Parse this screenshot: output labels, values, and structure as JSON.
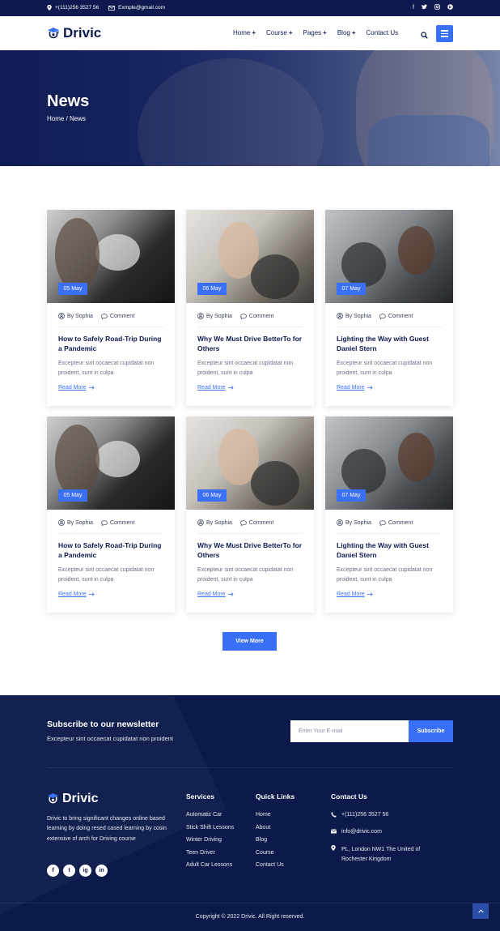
{
  "topbar": {
    "phone": "+(111)256 3527 56",
    "email": "Exmple@gmail.com",
    "social": [
      "facebook-icon",
      "twitter-icon",
      "instagram-icon",
      "pinterest-icon"
    ]
  },
  "header": {
    "brand": "Drivic",
    "nav": [
      {
        "label": "Home",
        "plus": "+"
      },
      {
        "label": "Course",
        "plus": "+"
      },
      {
        "label": "Pages",
        "plus": "+"
      },
      {
        "label": "Blog",
        "plus": "+"
      },
      {
        "label": "Contact Us",
        "plus": ""
      }
    ]
  },
  "hero": {
    "title": "News",
    "breadcrumb": "Home / News"
  },
  "posts": [
    {
      "date": "05 May",
      "author": "By Sophia",
      "comment": "Comment",
      "title": "How to Safely Road-Trip During a Pandemic",
      "desc": "Excepteur sint occaecat cupidatat non proident, sunt in culpa",
      "more": "Read More"
    },
    {
      "date": "06 May",
      "author": "By Sophia",
      "comment": "Comment",
      "title": "Why We Must Drive BetterTo for Others",
      "desc": "Excepteur sint occaecat cupidatat non proident, sunt in culpa",
      "more": "Read More"
    },
    {
      "date": "07 May",
      "author": "By Sophia",
      "comment": "Comment",
      "title": "Lighting the Way with Guest Daniel Stern",
      "desc": "Excepteur sint occaecat cupidatat non proident, sunt in culpa",
      "more": "Read More"
    },
    {
      "date": "05 May",
      "author": "By Sophia",
      "comment": "Comment",
      "title": "How to Safely Road-Trip During a Pandemic",
      "desc": "Excepteur sint occaecat cupidatat non proident, sunt in culpa",
      "more": "Read More"
    },
    {
      "date": "06 May",
      "author": "By Sophia",
      "comment": "Comment",
      "title": "Why We Must Drive BetterTo for Others",
      "desc": "Excepteur sint occaecat cupidatat non proident, sunt in culpa",
      "more": "Read More"
    },
    {
      "date": "07 May",
      "author": "By Sophia",
      "comment": "Comment",
      "title": "Lighting the Way with Guest Daniel Stern",
      "desc": "Excepteur sint occaecat cupidatat non proident, sunt in culpa",
      "more": "Read More"
    }
  ],
  "view_more": "View More",
  "newsletter": {
    "title": "Subscribe to our newsletter",
    "subtitle": "Excepteur sint occaecat cupidatat non proident",
    "placeholder": "Enter Your E-mail",
    "button": "Subscribe"
  },
  "footer": {
    "brand": "Drivic",
    "about": "Drivic to bring significant changes online based learning by doing resed cased learning by cosin extensive of arch for Driving course",
    "social": [
      "f",
      "t",
      "ig",
      "in"
    ],
    "services_title": "Services",
    "services": [
      "Automatic Car",
      "Stick Shift Lessons",
      "Winter Driving",
      "Teen Driver",
      "Adult Car Lessons"
    ],
    "quick_title": "Quick Links",
    "quick": [
      "Home",
      "About",
      "Blog",
      "Course",
      "Contact Us"
    ],
    "contact_title": "Contact Us",
    "contact_phone": "+(111)256 3527 56",
    "contact_email": "info@drivic.com",
    "contact_address": "PL, London NW1 The United of Rochester Kingdom",
    "copyright": "Copyright © 2022 Drivic. All Right reserved."
  },
  "colors": {
    "navy": "#0e1a4f",
    "accent": "#3a6ff7",
    "footer_bg": "#0b1a4a"
  }
}
